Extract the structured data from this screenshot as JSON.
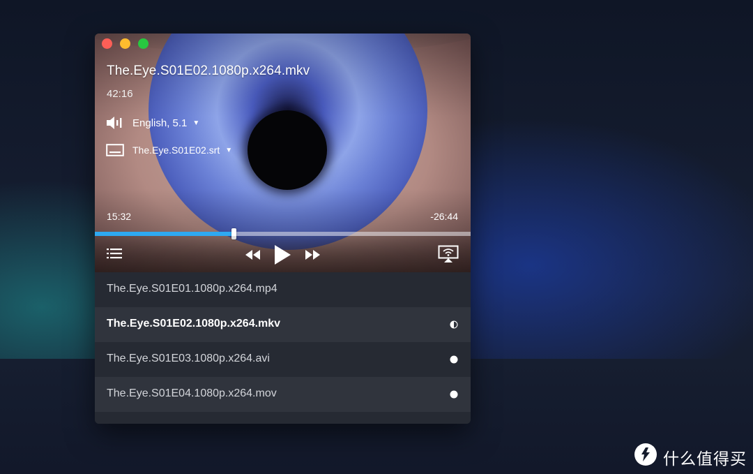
{
  "player": {
    "title": "The.Eye.S01E02.1080p.x264.mkv",
    "duration": "42:16",
    "audio_track": "English, 5.1",
    "subtitle_track": "The.Eye.S01E02.srt",
    "time_elapsed": "15:32",
    "time_remaining": "-26:44",
    "progress_fraction": 0.37,
    "accent_color": "#2ea9f1",
    "icons": {
      "close": "close-icon",
      "minimize": "minimize-icon",
      "maximize": "maximize-icon",
      "audio": "speaker-icon",
      "subtitle": "subtitle-icon",
      "playlist": "playlist-icon",
      "rewind": "rewind-icon",
      "play": "play-icon",
      "forward": "fast-forward-icon",
      "cast": "airplay-icon"
    }
  },
  "playlist": {
    "items": [
      {
        "name": "The.Eye.S01E01.1080p.x264.mp4",
        "status": "none"
      },
      {
        "name": "The.Eye.S01E02.1080p.x264.mkv",
        "status": "half-watched-icon"
      },
      {
        "name": "The.Eye.S01E03.1080p.x264.avi",
        "status": "unwatched-dot-icon"
      },
      {
        "name": "The.Eye.S01E04.1080p.x264.mov",
        "status": "unwatched-dot-icon"
      }
    ]
  },
  "watermark": {
    "text": "什么值得买",
    "logo": "value-logo-icon"
  }
}
